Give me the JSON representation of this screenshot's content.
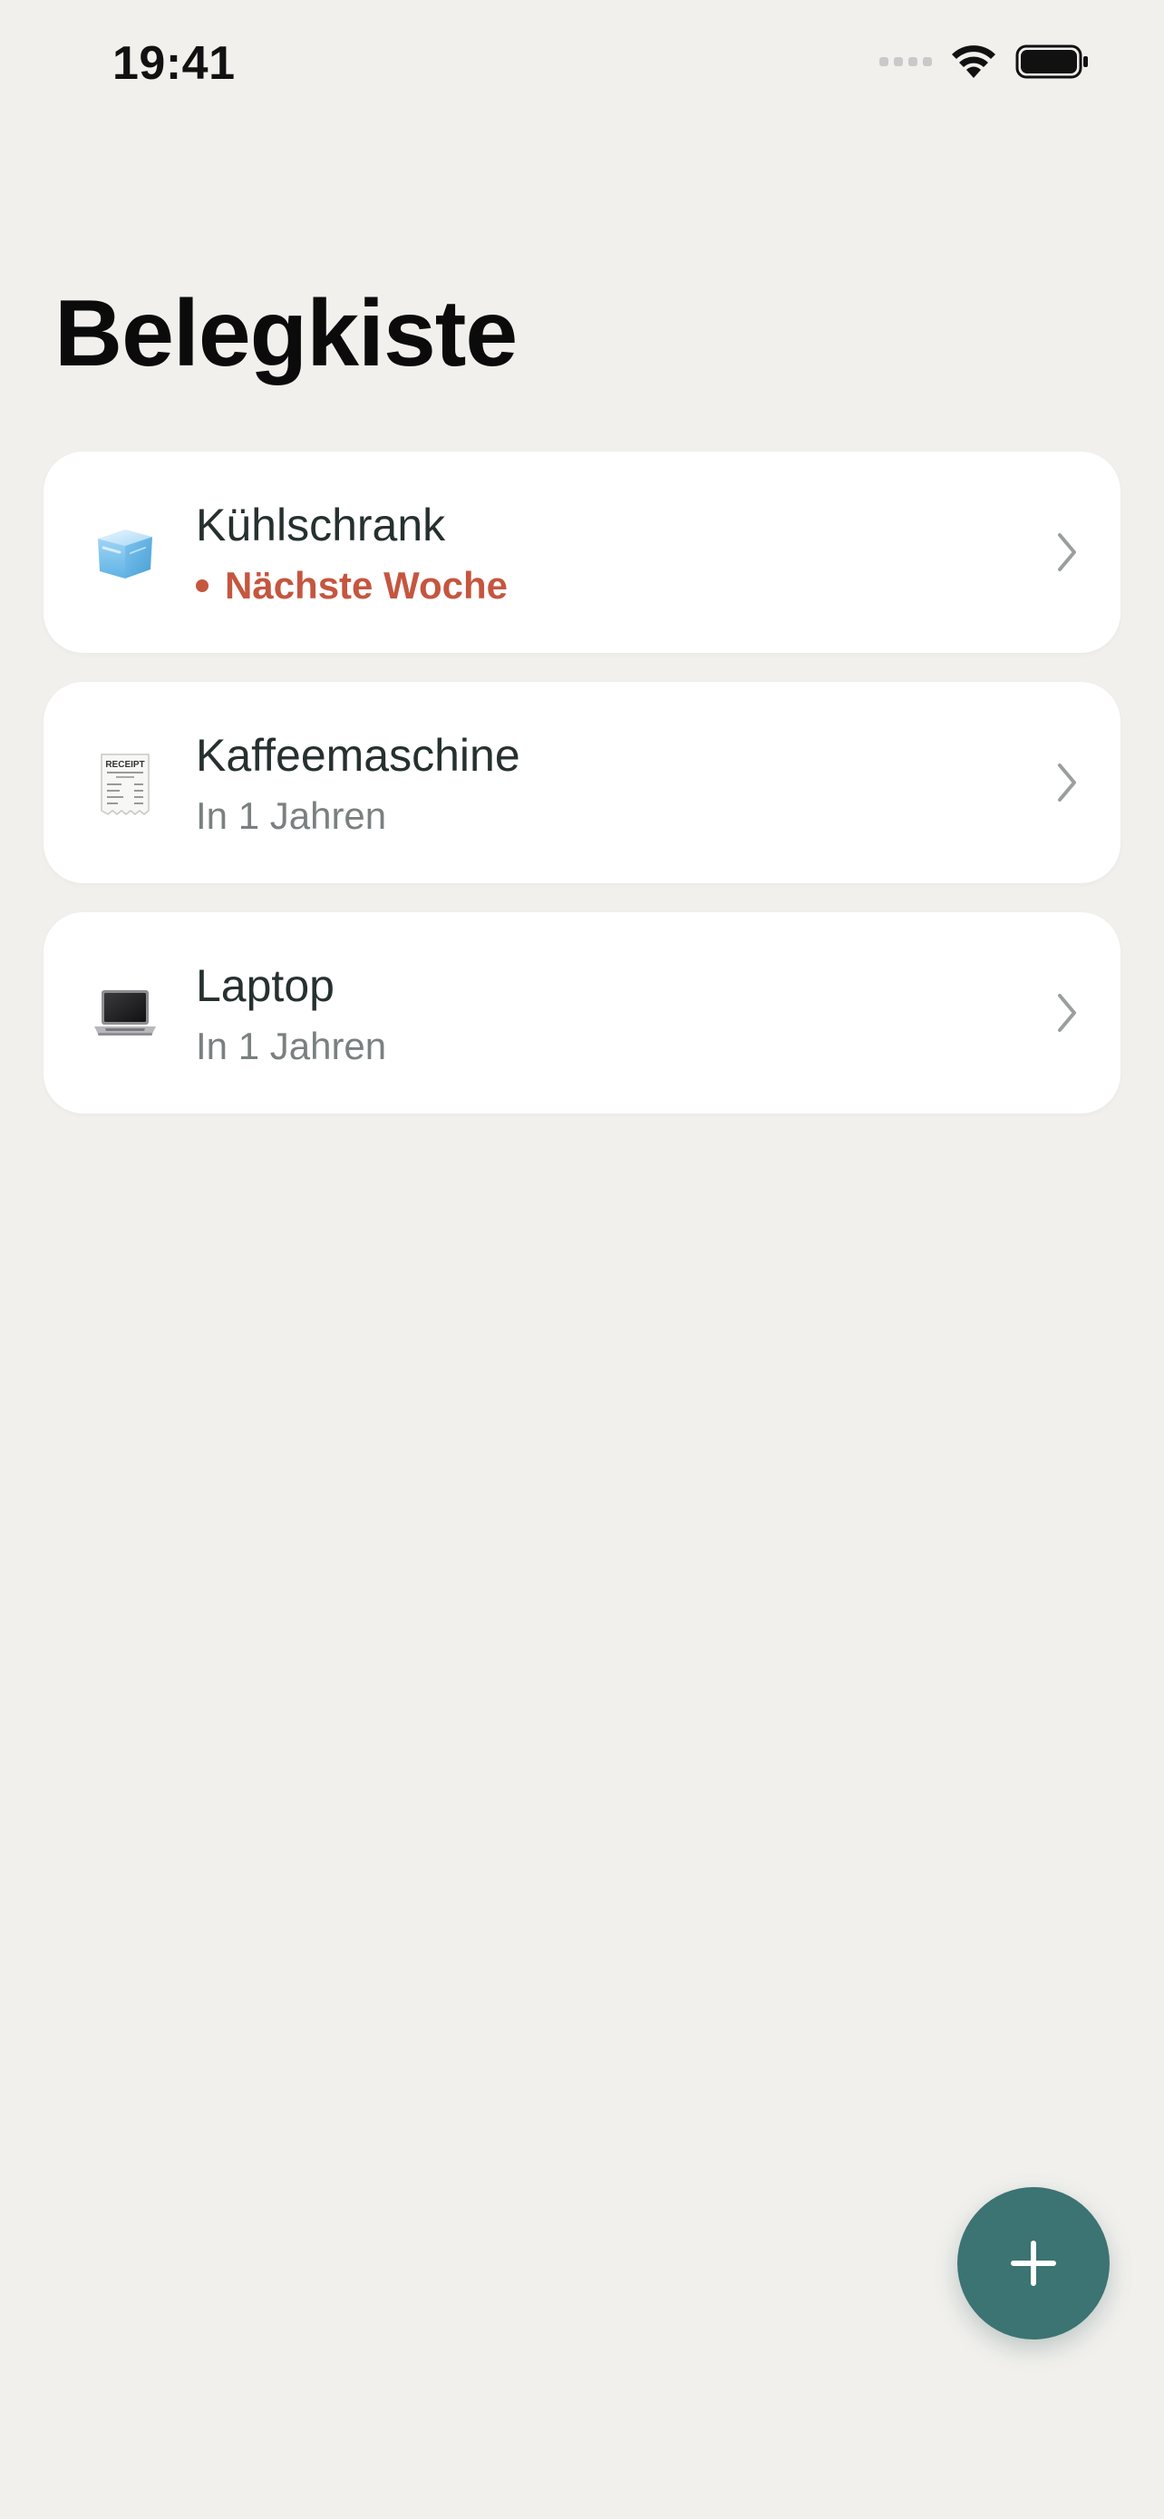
{
  "status_bar": {
    "time": "19:41"
  },
  "header": {
    "title": "Belegkiste"
  },
  "items": [
    {
      "icon": "ice-cube-icon",
      "title": "Kühlschrank",
      "subtitle": "Nächste Woche",
      "alert": true
    },
    {
      "icon": "receipt-icon",
      "title": "Kaffeemaschine",
      "subtitle": "In 1 Jahren",
      "alert": false
    },
    {
      "icon": "laptop-icon",
      "title": "Laptop",
      "subtitle": "In 1 Jahren",
      "alert": false
    }
  ],
  "receipt_icon_text": "RECEIPT",
  "colors": {
    "background": "#f1f0ed",
    "accent": "#3b7472",
    "alert": "#c5563f",
    "subtitle": "#7a8080"
  }
}
